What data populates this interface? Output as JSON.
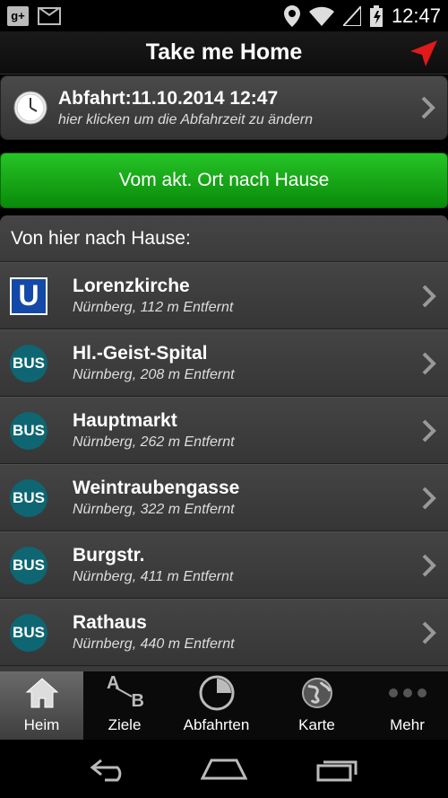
{
  "status_bar": {
    "time": "12:47",
    "left_icons": [
      "google-plus-icon",
      "gmail-icon"
    ],
    "right_icons": [
      "location-icon",
      "wifi-icon",
      "signal-icon",
      "battery-icon"
    ],
    "gplus_text": "g+"
  },
  "action_bar": {
    "title": "Take me Home",
    "locate_icon": "location-arrow-icon",
    "accent": "#e0191b"
  },
  "departure": {
    "label": "Abfahrt:",
    "datetime": "11.10.2014 12:47",
    "hint": "hier klicken um die Abfahrzeit zu ändern"
  },
  "go_home_button": {
    "label": "Vom akt. Ort nach Hause",
    "color": "#1aa81a"
  },
  "stops": {
    "header": "Von hier nach Hause:",
    "items": [
      {
        "name": "Lorenzkirche",
        "detail": "Nürnberg, 112 m Entfernt",
        "type": "U",
        "icon": "ubahn-icon"
      },
      {
        "name": "Hl.-Geist-Spital",
        "detail": "Nürnberg, 208 m Entfernt",
        "type": "BUS",
        "icon": "bus-icon"
      },
      {
        "name": "Hauptmarkt",
        "detail": "Nürnberg, 262 m Entfernt",
        "type": "BUS",
        "icon": "bus-icon"
      },
      {
        "name": "Weintraubengasse",
        "detail": "Nürnberg, 322 m Entfernt",
        "type": "BUS",
        "icon": "bus-icon"
      },
      {
        "name": "Burgstr.",
        "detail": "Nürnberg, 411 m Entfernt",
        "type": "BUS",
        "icon": "bus-icon"
      },
      {
        "name": "Rathaus",
        "detail": "Nürnberg, 440 m Entfernt",
        "type": "BUS",
        "icon": "bus-icon"
      }
    ]
  },
  "tabs": [
    {
      "label": "Heim",
      "icon": "home-icon",
      "active": true
    },
    {
      "label": "Ziele",
      "icon": "a-to-b-icon",
      "active": false,
      "icon_a": "A",
      "icon_b": "B"
    },
    {
      "label": "Abfahrten",
      "icon": "clock-pie-icon",
      "active": false
    },
    {
      "label": "Karte",
      "icon": "globe-icon",
      "active": false
    },
    {
      "label": "Mehr",
      "icon": "more-dots-icon",
      "active": false
    }
  ],
  "nav_bar": [
    "back-icon",
    "home-nav-icon",
    "recents-icon"
  ]
}
